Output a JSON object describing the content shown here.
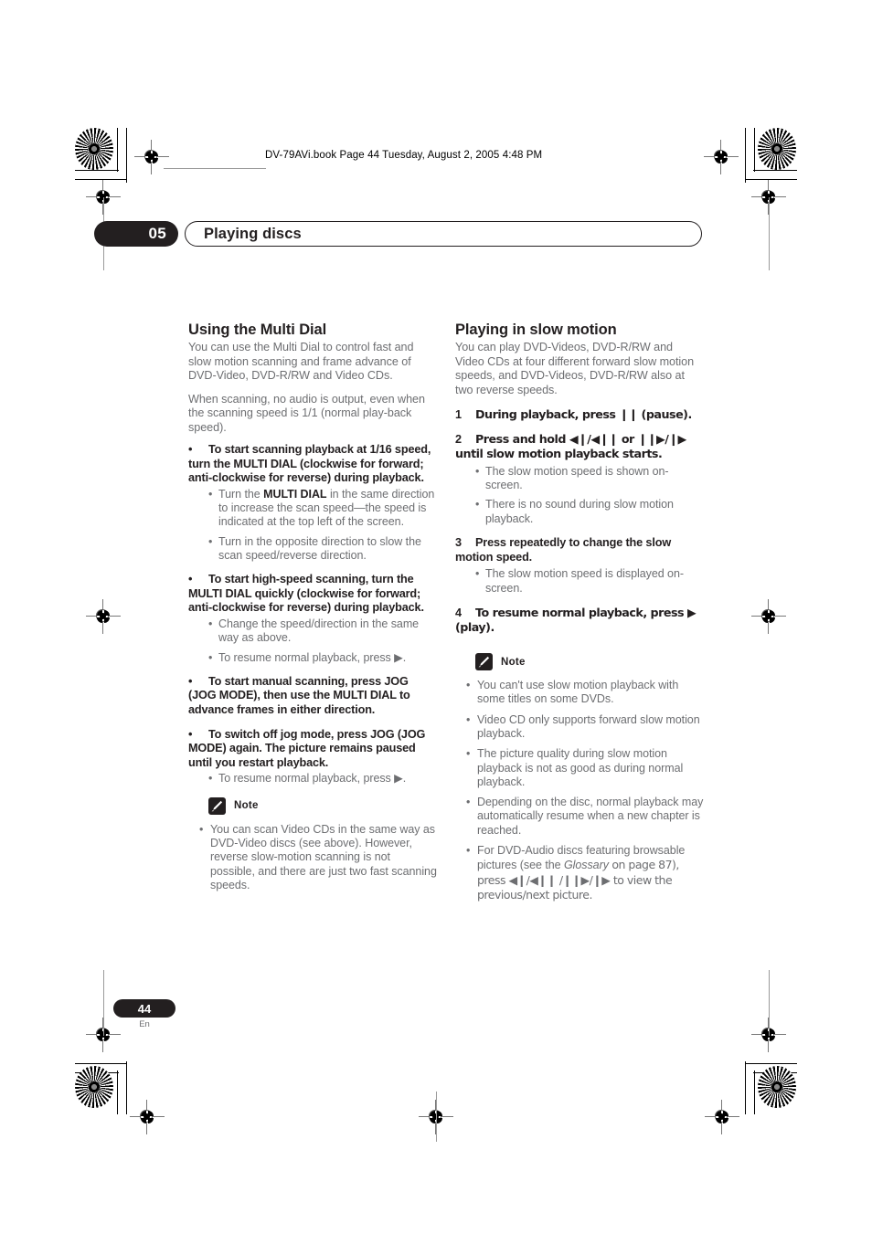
{
  "print_header": "DV-79AVi.book  Page 44  Tuesday, August 2, 2005  4:48 PM",
  "chapter": {
    "number": "05",
    "title": "Playing discs"
  },
  "left_column": {
    "section_title": "Using the Multi Dial",
    "intro_1": "You can use the Multi Dial to control fast and slow motion scanning and frame advance of DVD-Video, DVD-R/RW and Video CDs.",
    "intro_2": "When scanning, no audio is output, even when the scanning speed is 1/1 (normal play-back speed).",
    "blocks": [
      {
        "bullet": "•",
        "heading": "To start scanning playback at 1/16 speed, turn the MULTI DIAL (clockwise for forward; anti-clockwise for reverse) during playback.",
        "sub": [
          {
            "pre": "Turn the ",
            "bold": "MULTI DIAL",
            "post": " in the same direction to increase the scan speed—the speed is indicated at the top left of the screen."
          },
          {
            "pre": "Turn in the opposite direction to slow the scan speed/reverse direction.",
            "bold": "",
            "post": ""
          }
        ]
      },
      {
        "bullet": "•",
        "heading": "To start high-speed scanning, turn the MULTI DIAL quickly (clockwise for forward; anti-clockwise for reverse) during playback.",
        "sub": [
          {
            "pre": "Change the speed/direction in the same way as above.",
            "bold": "",
            "post": ""
          },
          {
            "pre": "To resume normal playback, press ▶.",
            "bold": "",
            "post": ""
          }
        ]
      },
      {
        "bullet": "•",
        "heading": "To start manual scanning, press JOG (JOG MODE), then use the MULTI DIAL to advance frames in either direction.",
        "sub": []
      },
      {
        "bullet": "•",
        "heading": "To switch off jog mode, press JOG (JOG MODE) again. The picture remains paused until you restart playback.",
        "sub": [
          {
            "pre": "To resume normal playback, press ▶.",
            "bold": "",
            "post": ""
          }
        ]
      }
    ],
    "note": {
      "label": "Note",
      "items": [
        "You can scan Video CDs in the same way as DVD-Video discs (see above). However, reverse slow-motion scanning is not possible, and there are just two fast scanning speeds."
      ]
    }
  },
  "right_column": {
    "section_title": "Playing in slow motion",
    "intro_1": "You can play DVD-Videos, DVD-R/RW and Video CDs at four different forward slow motion speeds, and DVD-Videos, DVD-R/RW also at two reverse speeds.",
    "steps": [
      {
        "num": "1",
        "text": "During playback, press ❙❙ (pause).",
        "sub": []
      },
      {
        "num": "2",
        "text": "Press and hold ◀❙/◀❙❙ or ❙❙▶/❙▶ until slow motion playback starts.",
        "sub": [
          "The slow motion speed is shown on-screen.",
          "There is no sound during slow motion playback."
        ]
      },
      {
        "num": "3",
        "text": "Press repeatedly to change the slow motion speed.",
        "sub": [
          "The slow motion speed is displayed on-screen."
        ]
      },
      {
        "num": "4",
        "text": "To resume normal playback, press ▶ (play).",
        "sub": []
      }
    ],
    "note": {
      "label": "Note",
      "items": [
        {
          "pre": "You can't use slow motion playback with some titles on some DVDs.",
          "italic": "",
          "post": ""
        },
        {
          "pre": "Video CD only supports forward slow motion playback.",
          "italic": "",
          "post": ""
        },
        {
          "pre": "The picture quality during slow motion playback is not as good as during normal playback.",
          "italic": "",
          "post": ""
        },
        {
          "pre": "Depending on the disc, normal playback may automatically resume when a new chapter is reached.",
          "italic": "",
          "post": ""
        },
        {
          "pre": "For DVD-Audio discs featuring browsable pictures (see the ",
          "italic": "Glossary",
          "post": " on page 87), press ◀❙/◀❙❙ /❙❙▶/❙▶ to view the previous/next picture."
        }
      ]
    }
  },
  "footer": {
    "page_number": "44",
    "language": "En"
  },
  "colors": {
    "ink_black": "#231f20",
    "body_gray": "#6d6e71",
    "page_white": "#ffffff"
  }
}
